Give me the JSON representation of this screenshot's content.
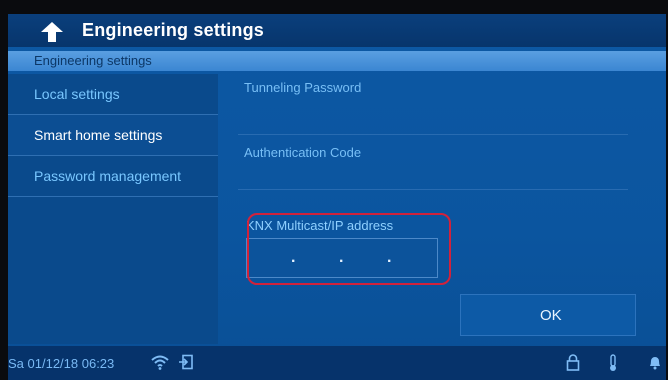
{
  "header": {
    "title": "Engineering settings",
    "subheader": "Engineering settings"
  },
  "sidebar": {
    "items": [
      {
        "label": "Local settings"
      },
      {
        "label": "Smart home settings"
      },
      {
        "label": "Password management"
      }
    ],
    "active": "Smart home settings"
  },
  "main": {
    "tunneling_label": "Tunneling Password",
    "auth_label": "Authentication Code",
    "knx_label": "KNX Multicast/IP address",
    "ip_dots": [
      ".",
      ".",
      "."
    ],
    "ok_label": "OK"
  },
  "status": {
    "datetime": "Sa 01/12/18  06:23",
    "icons": [
      "wifi-icon",
      "exit-icon",
      "lock-icon",
      "thermometer-icon",
      "bell-icon"
    ]
  },
  "colors": {
    "screen_bg": "#0b559f",
    "highlight": "#d2223b",
    "label": "#78bff6"
  }
}
